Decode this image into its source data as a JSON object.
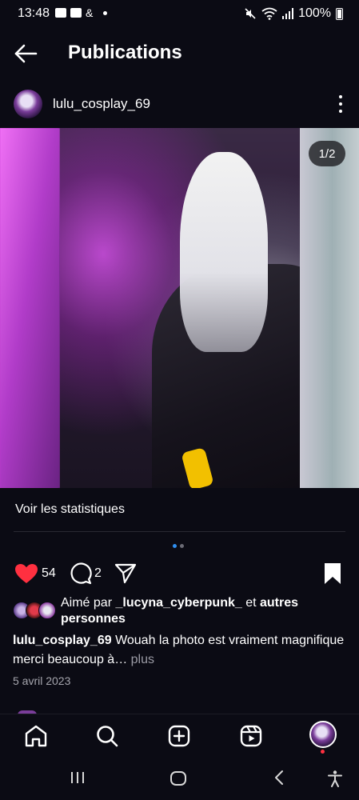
{
  "status_bar": {
    "time": "13:48",
    "left_icons": [
      "gallery-icon",
      "youtube-icon",
      "ampersand-icon",
      "dot-icon"
    ],
    "ampersand": "&",
    "right_icons": [
      "mute-icon",
      "wifi-icon",
      "signal-icon",
      "battery-icon"
    ],
    "battery": "100%"
  },
  "top_bar": {
    "back_icon": "arrow-left-icon",
    "title": "Publications"
  },
  "post": {
    "username": "lulu_cosplay_69",
    "media": {
      "counter": "1/2",
      "current_slide": 1,
      "total_slides": 2
    },
    "stats_link": "Voir les statistiques",
    "likes": "54",
    "comments": "2",
    "liked_by": {
      "prefix": "Aimé par ",
      "user": "_lucyna_cyberpunk_",
      "middle": " et ",
      "others": "autres personnes"
    },
    "caption": {
      "user": "lulu_cosplay_69",
      "text": " Wouah la photo est vraiment magnifique merci beaucoup à…",
      "more": " plus"
    },
    "date": "5 avril 2023"
  },
  "colors": {
    "background": "#0b0b14",
    "like_red": "#ff3040",
    "dot_active": "#2f8ff0"
  },
  "bottom_nav": [
    "home-icon",
    "search-icon",
    "create-icon",
    "reels-icon",
    "profile-avatar"
  ],
  "android_nav": [
    "recents-icon",
    "home-circle-icon",
    "back-icon",
    "accessibility-icon"
  ]
}
